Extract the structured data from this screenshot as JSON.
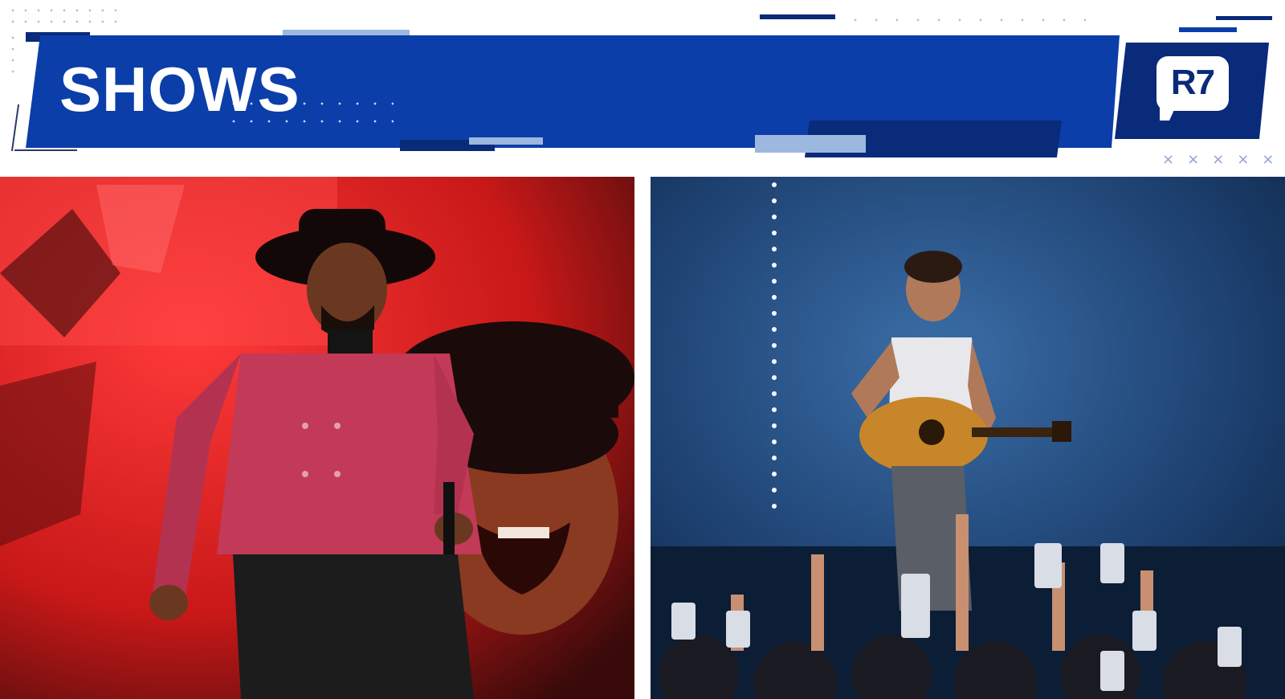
{
  "header": {
    "title": "SHOWS",
    "logo_text": "R7",
    "decor_marks": "×××××"
  },
  "colors": {
    "band_blue": "#0b3ea8",
    "navy": "#0a2a7a",
    "light_blue": "#9db8e0"
  },
  "photos": [
    {
      "name": "singer-in-hat-photo",
      "description_icon": "photo-icon"
    },
    {
      "name": "guitarist-concert-photo",
      "description_icon": "photo-icon"
    }
  ]
}
